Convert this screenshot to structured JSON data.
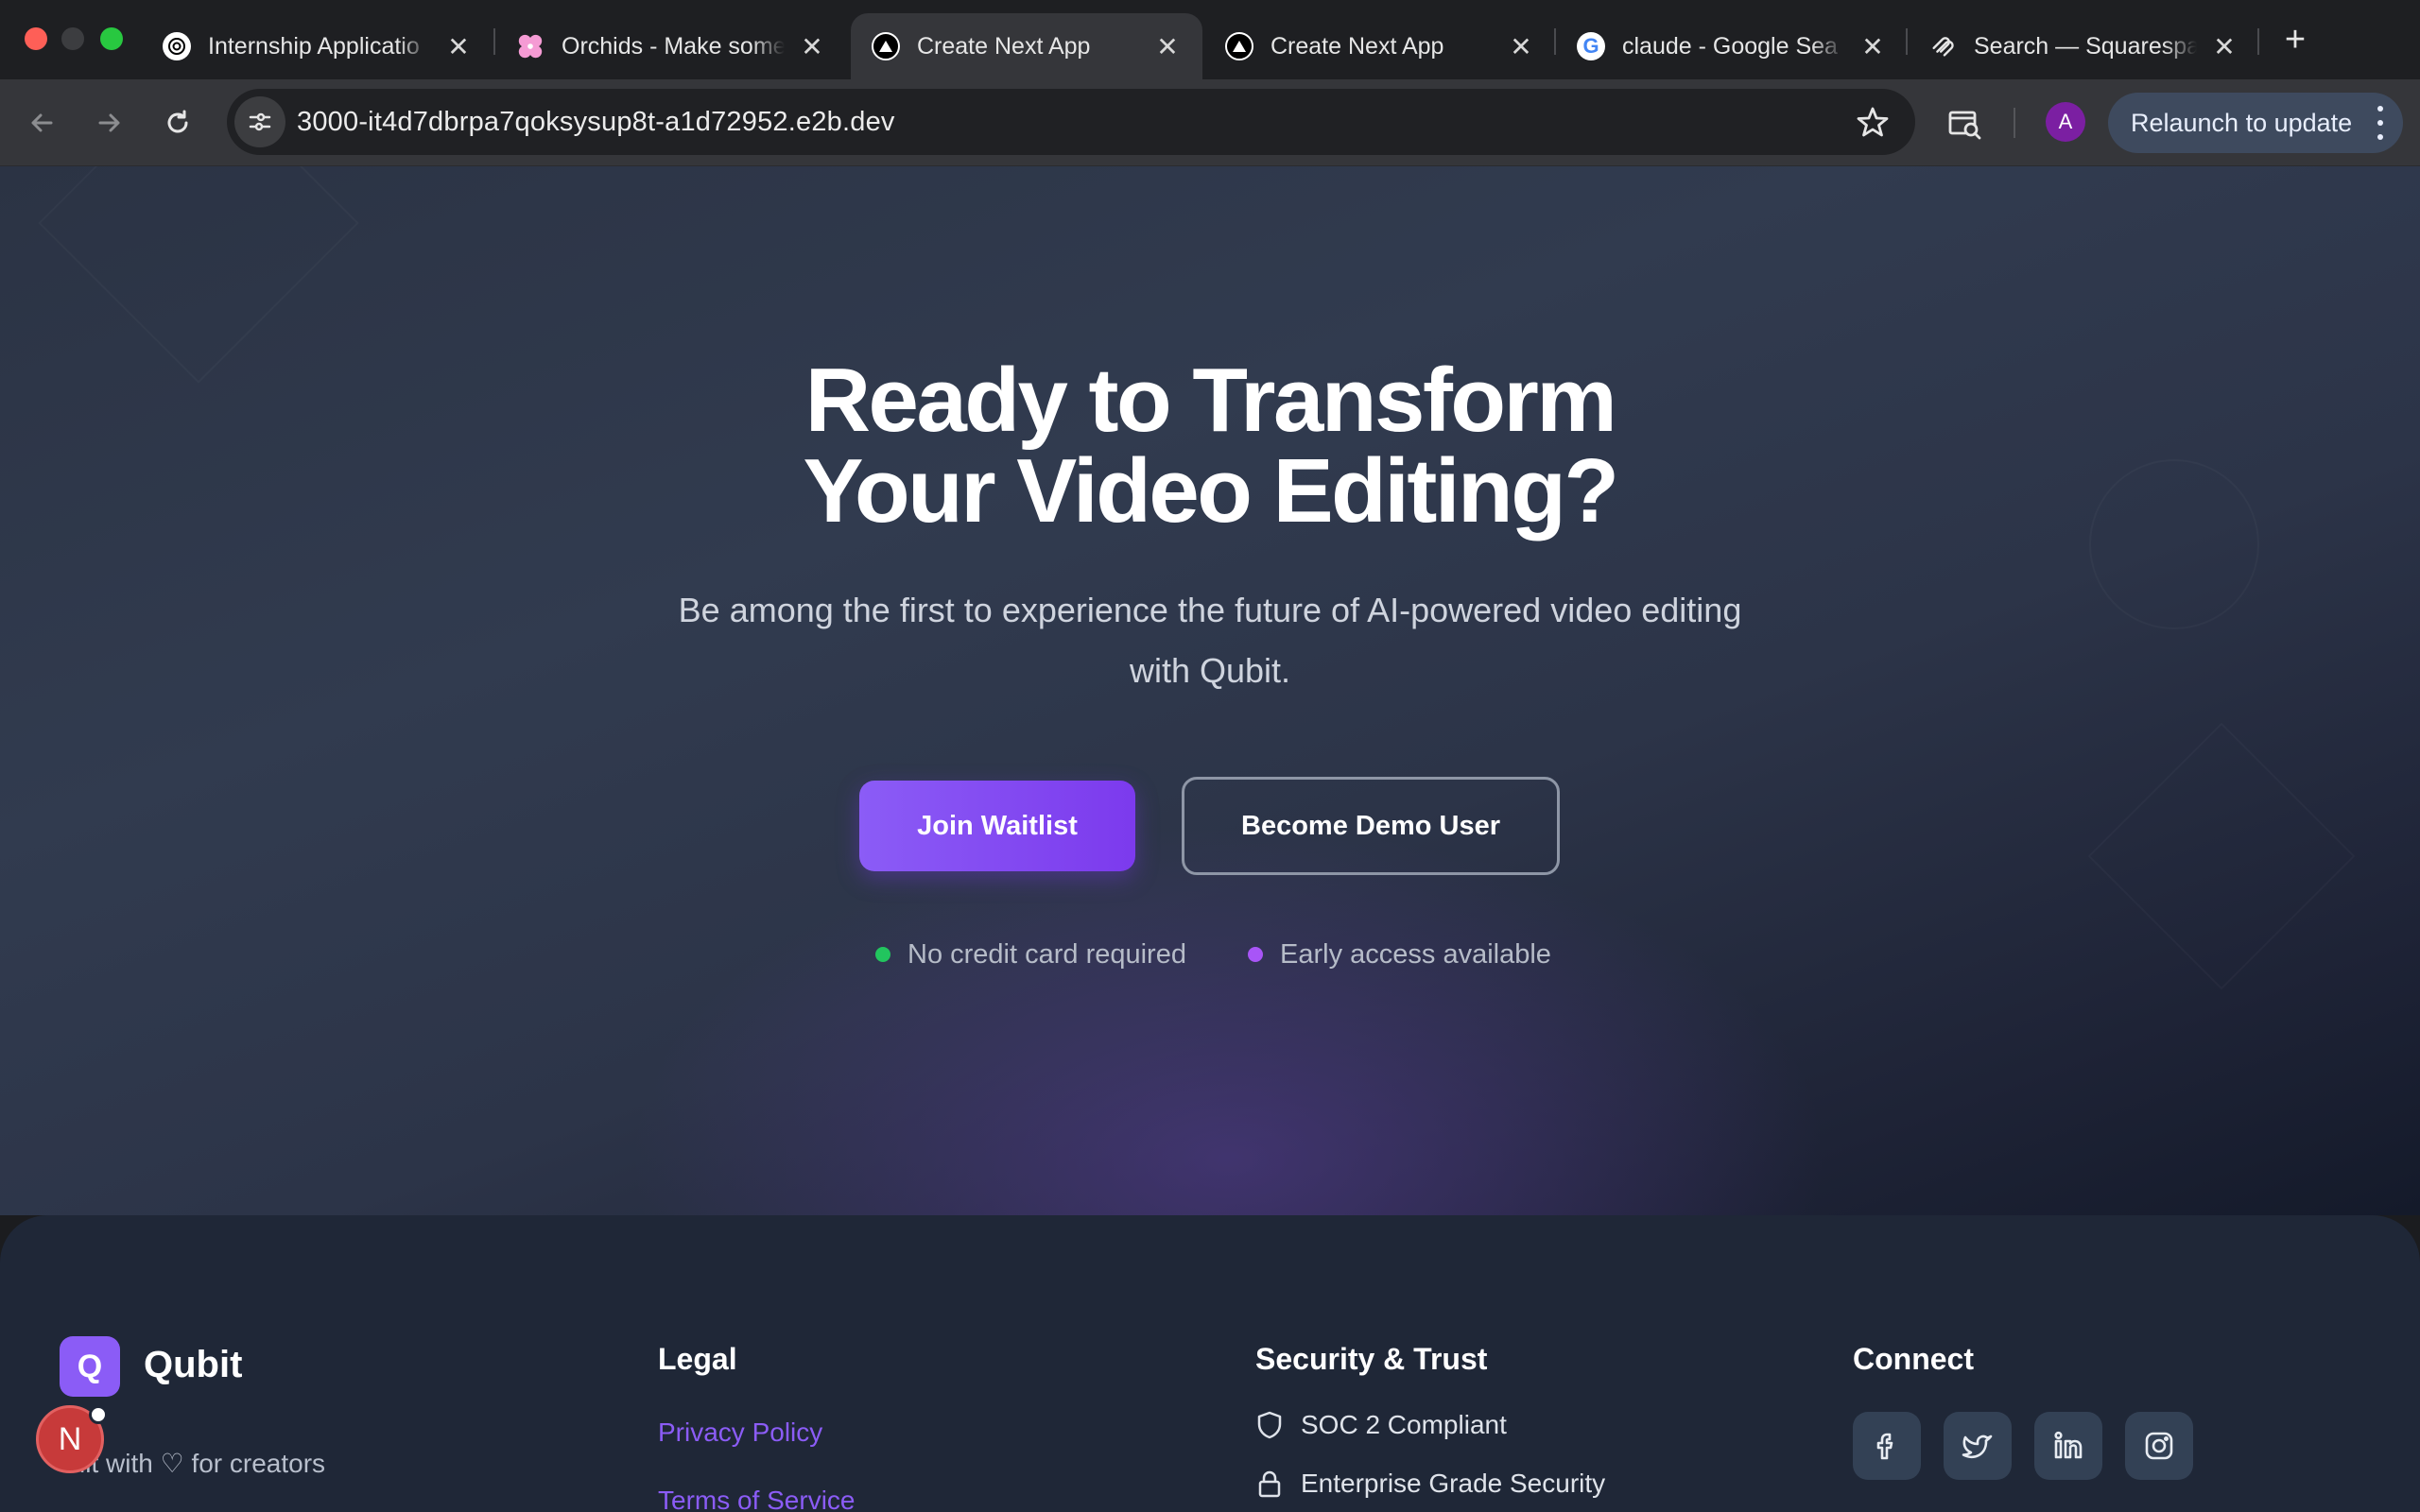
{
  "browser": {
    "tabs": [
      {
        "title": "Internship Applicatio",
        "favicon": "openai-icon"
      },
      {
        "title": "Orchids - Make some",
        "favicon": "orchid-flower-icon"
      },
      {
        "title": "Create Next App",
        "favicon": "triangle-logo-icon",
        "active": true
      },
      {
        "title": "Create Next App",
        "favicon": "triangle-logo-icon"
      },
      {
        "title": "claude - Google Sea",
        "favicon": "google-icon"
      },
      {
        "title": "Search — Squarespa",
        "favicon": "squarespace-icon"
      }
    ],
    "new_tab": "+",
    "url": "3000-it4d7dbrpa7qoksysup8t-a1d72952.e2b.dev",
    "profile_initial": "A",
    "relaunch_label": "Relaunch to update"
  },
  "hero": {
    "title_line1": "Ready to Transform",
    "title_line2": "Your Video Editing?",
    "subtitle": "Be among the first to experience the future of AI-powered video editing with Qubit.",
    "primary_cta": "Join Waitlist",
    "secondary_cta": "Become Demo User",
    "features": [
      {
        "label": "No credit card required",
        "dot_color": "#22c55e"
      },
      {
        "label": "Early access available",
        "dot_color": "#a855f7"
      }
    ]
  },
  "footer": {
    "logo_letter": "Q",
    "brand": "Qubit",
    "tagline": "ilt with ♡ for creators",
    "legal_title": "Legal",
    "legal_links": [
      "Privacy Policy",
      "Terms of Service"
    ],
    "security_title": "Security & Trust",
    "security_items": [
      "SOC 2 Compliant",
      "Enterprise Grade Security"
    ],
    "connect_title": "Connect",
    "social": [
      "facebook-icon",
      "twitter-icon",
      "linkedin-icon",
      "instagram-icon"
    ]
  },
  "overlay_badge": "N",
  "colors": {
    "accent": "#8b5cf6",
    "hero_bg": "#2b3344",
    "footer_bg": "#1f2737"
  }
}
